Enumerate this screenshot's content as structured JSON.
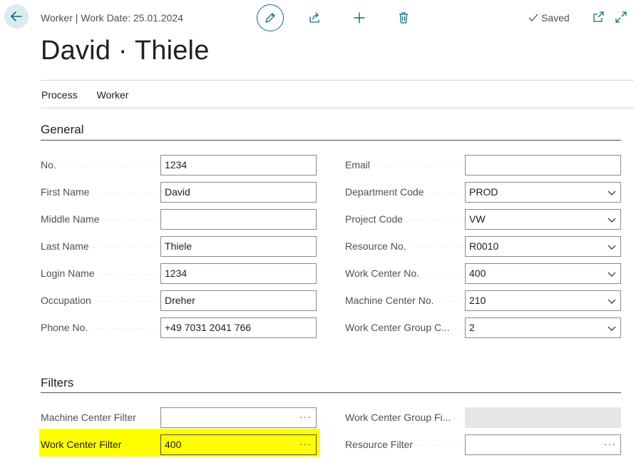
{
  "header": {
    "context": "Worker | Work Date: 25.01.2024",
    "title": "David · Thiele",
    "saved_label": "Saved"
  },
  "menu": {
    "items": [
      "Process",
      "Worker"
    ]
  },
  "general": {
    "title": "General",
    "left": [
      {
        "label": "No.",
        "value": "1234"
      },
      {
        "label": "First Name",
        "value": "David"
      },
      {
        "label": "Middle Name",
        "value": ""
      },
      {
        "label": "Last Name",
        "value": "Thiele"
      },
      {
        "label": "Login Name",
        "value": "1234"
      },
      {
        "label": "Occupation",
        "value": "Dreher"
      },
      {
        "label": "Phone No.",
        "value": "+49 7031 2041 766"
      }
    ],
    "right": [
      {
        "label": "Email",
        "value": ""
      },
      {
        "label": "Department Code",
        "value": "PROD"
      },
      {
        "label": "Project Code",
        "value": "VW"
      },
      {
        "label": "Resource No.",
        "value": "R0010"
      },
      {
        "label": "Work Center No.",
        "value": "400"
      },
      {
        "label": "Machine Center No.",
        "value": "210"
      },
      {
        "label": "Work Center Group C...",
        "value": "2"
      }
    ]
  },
  "filters": {
    "title": "Filters",
    "left": [
      {
        "label": "Machine Center Filter",
        "value": ""
      },
      {
        "label": "Work Center Filter",
        "value": "400"
      }
    ],
    "right": [
      {
        "label": "Work Center Group Fi...",
        "value": ""
      },
      {
        "label": "Resource Filter",
        "value": ""
      }
    ]
  },
  "colors": {
    "accent": "#0a6e7d",
    "highlight": "#ffff00"
  }
}
